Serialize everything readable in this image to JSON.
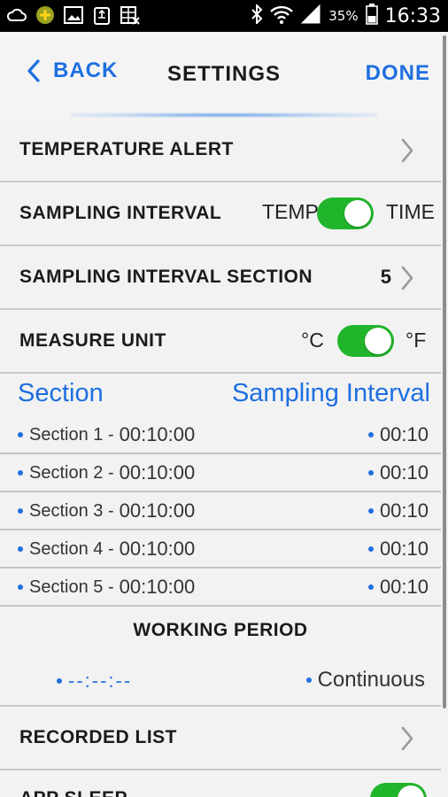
{
  "status_bar": {
    "battery_percent": "35%",
    "time": "16:33"
  },
  "nav": {
    "back_label": "BACK",
    "title": "SETTINGS",
    "done_label": "DONE"
  },
  "settings": {
    "temperature_alert": {
      "label": "TEMPERATURE ALERT"
    },
    "sampling_interval": {
      "label": "SAMPLING INTERVAL",
      "left_option": "TEMP",
      "right_option": "TIME",
      "toggle_on": true
    },
    "sampling_interval_section": {
      "label": "SAMPLING INTERVAL SECTION",
      "value": "5"
    },
    "measure_unit": {
      "label": "MEASURE UNIT",
      "left_option": "°C",
      "right_option": "°F",
      "toggle_on": true
    }
  },
  "sections": {
    "header_left": "Section",
    "header_right": "Sampling Interval",
    "rows": [
      {
        "name": "Section 1 -",
        "time": "00:10:00",
        "interval": "00:10"
      },
      {
        "name": "Section 2 -",
        "time": "00:10:00",
        "interval": "00:10"
      },
      {
        "name": "Section 3 -",
        "time": "00:10:00",
        "interval": "00:10"
      },
      {
        "name": "Section 4 -",
        "time": "00:10:00",
        "interval": "00:10"
      },
      {
        "name": "Section 5 -",
        "time": "00:10:00",
        "interval": "00:10"
      }
    ]
  },
  "working_period": {
    "title": "WORKING PERIOD",
    "left_value": "--:--:--",
    "right_value": "Continuous"
  },
  "recorded_list": {
    "label": "RECORDED LIST"
  },
  "app_sleep": {
    "label": "APP SLEEP",
    "toggle_on": true
  },
  "colors": {
    "accent": "#1e6fe0",
    "toggle_green": "#21b52b",
    "background": "#f2f2f2"
  }
}
